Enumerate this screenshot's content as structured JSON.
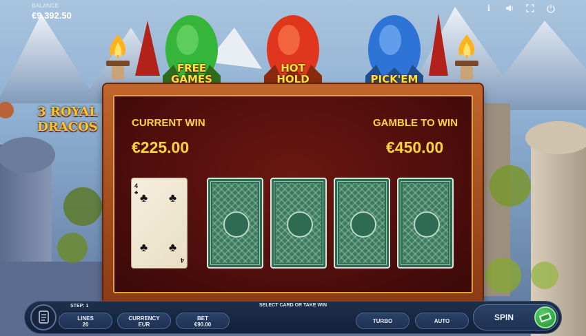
{
  "balance": {
    "label": "BALANCE",
    "value": "€9,392.50"
  },
  "top_icons": [
    "info-icon",
    "sound-icon",
    "fullscreen-icon",
    "power-icon"
  ],
  "logo": {
    "line1": "3 ROYAL",
    "line2": "DRACOS"
  },
  "eggs": [
    {
      "label_line1": "FREE",
      "label_line2": "GAMES",
      "color": "#35b53a"
    },
    {
      "label_line1": "HOT",
      "label_line2": "HOLD",
      "color": "#e0361e"
    },
    {
      "label_line1": "PICK'EM",
      "label_line2": "",
      "color": "#2e73d6"
    }
  ],
  "gamble": {
    "current_win_label": "CURRENT WIN",
    "current_win_value": "€225.00",
    "gamble_label": "GAMBLE TO WIN",
    "gamble_value": "€450.00",
    "revealed_card": {
      "rank": "4",
      "suit": "♣"
    },
    "hidden_cards": 4
  },
  "footer": {
    "step": "STEP: 1",
    "hint": "SELECT CARD OR TAKE WIN",
    "lines_label": "LINES",
    "lines_value": "20",
    "currency_label": "CURRENCY",
    "currency_value": "EUR",
    "bet_label": "BET",
    "bet_value": "€90.00",
    "turbo_label": "TURBO",
    "auto_label": "AUTO",
    "spin_label": "SPIN"
  },
  "colors": {
    "gold_text": "#ffd43a",
    "panel_bg": "#4a0d0b",
    "card_back": "#2f6b52",
    "spin_green": "#2fa542"
  }
}
